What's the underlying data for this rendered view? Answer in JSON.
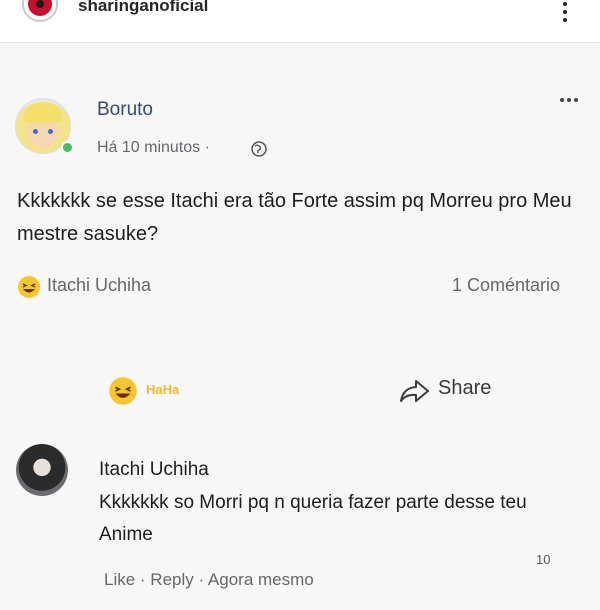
{
  "header": {
    "username": "sharinganoficial"
  },
  "post": {
    "author": "Boruto",
    "time": "Há 10 minutos ·",
    "text": "Kkkkkkk se esse Itachi era tão Forte assim pq Morreu pro Meu mestre sasuke?",
    "reaction_user": "Itachi Uchiha",
    "comment_count": "1 Coméntario",
    "haha_label": "HaHa",
    "share_label": "Share"
  },
  "comment": {
    "author": "Itachi Uchiha",
    "text": "Kkkkkkk so Morri pq n queria fazer parte desse teu Anime",
    "reaction_count": "10",
    "actions": "Like · Reply · Agora mesmo"
  },
  "colors": {
    "online": "#45bd62",
    "haha": "#f7b928",
    "brand_red": "#c8102e"
  },
  "icons": [
    "more-vertical-icon",
    "globe-icon",
    "more-horizontal-icon",
    "haha-emoji-icon",
    "share-icon"
  ]
}
